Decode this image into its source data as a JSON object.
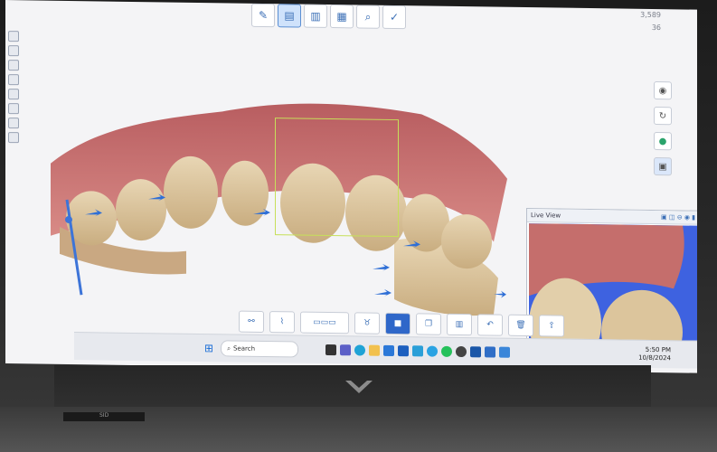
{
  "stats": {
    "triangles": "3,589",
    "shots": "36"
  },
  "live_view": {
    "title": "Live View"
  },
  "taskbar": {
    "search_label": "Search",
    "time": "5:50 PM",
    "date": "10/8/2024"
  },
  "device": {
    "keyboard_label": "SID"
  },
  "colors": {
    "gum": "#c46a6a",
    "tooth": "#dcc7a0",
    "accent_blue": "#2f67c9",
    "roi_green": "#c6e05a",
    "live_bg": "#3e62e0"
  },
  "icons": {
    "top_toolbar": [
      "pencil-icon",
      "scan-upper-icon",
      "scan-lower-icon",
      "bite-icon",
      "search-icon",
      "check-icon"
    ],
    "right_tools": [
      "camera-icon",
      "rotate-icon",
      "color-icon",
      "layers-icon"
    ],
    "bottom_tools": [
      "trim-icon",
      "brush-icon",
      "slider-icon",
      "tooth-icon",
      "stop-icon",
      "copy-icon",
      "fill-icon",
      "undo-icon",
      "delete-icon",
      "export-icon"
    ]
  }
}
